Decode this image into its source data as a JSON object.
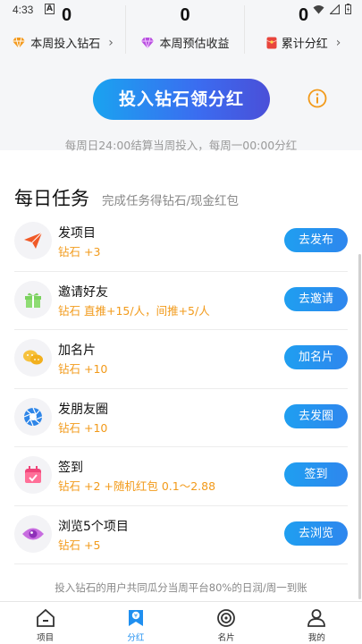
{
  "status_bar": {
    "time": "4:33",
    "badge": "A"
  },
  "stats": [
    {
      "value": "0",
      "label": "本周投入钻石",
      "icon": "diamond-orange-icon",
      "has_chevron": true
    },
    {
      "value": "0",
      "label": "本周预估收益",
      "icon": "diamond-purple-icon",
      "has_chevron": false
    },
    {
      "value": "0",
      "label": "累计分红",
      "icon": "red-envelope-icon",
      "has_chevron": true
    }
  ],
  "cta": {
    "label": "投入钻石领分红"
  },
  "settle_note": "每周日24:00结算当周投入，每周一00:00分红",
  "section": {
    "title": "每日任务",
    "subtitle": "完成任务得钻石/现金红包"
  },
  "tasks": [
    {
      "name": "发项目",
      "reward": "钻石 +3",
      "button": "去发布",
      "icon": "paper-plane-icon"
    },
    {
      "name": "邀请好友",
      "reward": "钻石 直推+15/人，间推+5/人",
      "button": "去邀请",
      "icon": "gift-icon"
    },
    {
      "name": "加名片",
      "reward": "钻石 +10",
      "button": "加名片",
      "icon": "chat-bubbles-icon"
    },
    {
      "name": "发朋友圈",
      "reward": "钻石 +10",
      "button": "去发圈",
      "icon": "camera-shutter-icon"
    },
    {
      "name": "签到",
      "reward": "钻石 +2 +随机红包 0.1～2.88",
      "button": "签到",
      "icon": "calendar-check-icon"
    },
    {
      "name": "浏览5个项目",
      "reward": "钻石 +5",
      "button": "去浏览",
      "icon": "eye-icon"
    }
  ],
  "bottom_note": "投入钻石的用户共同瓜分当周平台80%的日润/周一到账",
  "tabs": [
    {
      "label": "项目",
      "icon": "home-icon",
      "active": false
    },
    {
      "label": "分红",
      "icon": "dividend-icon",
      "active": true
    },
    {
      "label": "名片",
      "icon": "target-icon",
      "active": false
    },
    {
      "label": "我的",
      "icon": "person-icon",
      "active": false
    }
  ],
  "colors": {
    "accent": "#1f8ff0",
    "reward": "#f29a1a"
  }
}
